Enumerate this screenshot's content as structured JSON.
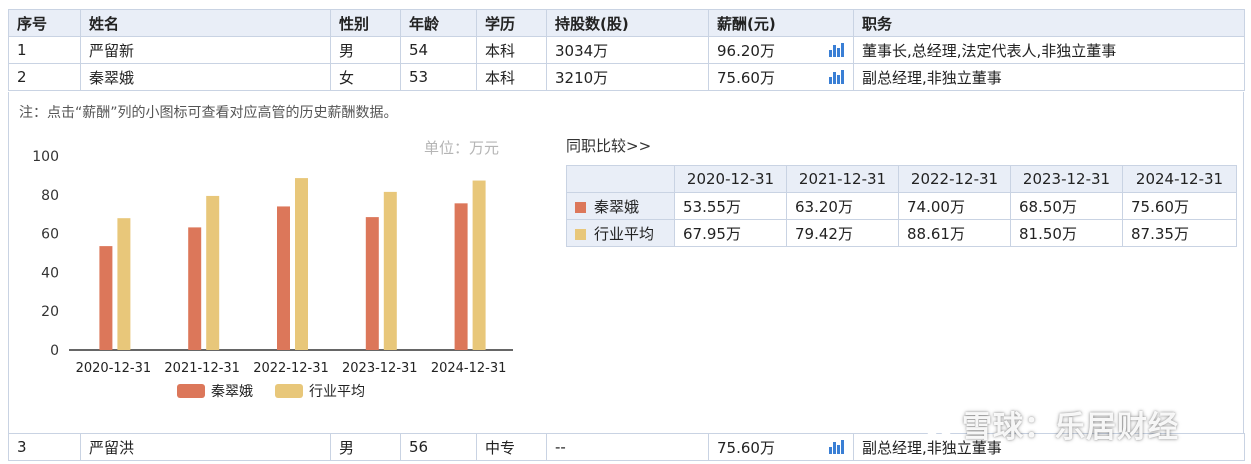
{
  "table": {
    "headers": [
      "序号",
      "姓名",
      "性别",
      "年龄",
      "学历",
      "持股数(股)",
      "薪酬(元)",
      "职务"
    ],
    "rows": [
      {
        "no": "1",
        "name": "严留新",
        "gender": "男",
        "age": "54",
        "edu": "本科",
        "shares": "3034万",
        "salary": "96.20万",
        "title": "董事长,总经理,法定代表人,非独立董事"
      },
      {
        "no": "2",
        "name": "秦翠娥",
        "gender": "女",
        "age": "53",
        "edu": "本科",
        "shares": "3210万",
        "salary": "75.60万",
        "title": "副总经理,非独立董事"
      },
      {
        "no": "3",
        "name": "严留洪",
        "gender": "男",
        "age": "56",
        "edu": "中专",
        "shares": "--",
        "salary": "75.60万",
        "title": "副总经理,非独立董事"
      }
    ]
  },
  "detail": {
    "note": "注：点击“薪酬”列的小图标可查看对应高管的历史薪酬数据。",
    "unit": "单位：万元",
    "compare_title": "同职比较>>",
    "compare_headers": [
      "2020-12-31",
      "2021-12-31",
      "2022-12-31",
      "2023-12-31",
      "2024-12-31"
    ],
    "compare_rows": [
      {
        "label": "秦翠娥",
        "color": "#dc775a",
        "values": [
          "53.55万",
          "63.20万",
          "74.00万",
          "68.50万",
          "75.60万"
        ]
      },
      {
        "label": "行业平均",
        "color": "#e8c77a",
        "values": [
          "67.95万",
          "79.42万",
          "88.61万",
          "81.50万",
          "87.35万"
        ]
      }
    ]
  },
  "chart_data": {
    "type": "bar",
    "categories": [
      "2020-12-31",
      "2021-12-31",
      "2022-12-31",
      "2023-12-31",
      "2024-12-31"
    ],
    "series": [
      {
        "name": "秦翠娥",
        "color": "#dc775a",
        "values": [
          53.55,
          63.2,
          74.0,
          68.5,
          75.6
        ]
      },
      {
        "name": "行业平均",
        "color": "#e8c77a",
        "values": [
          67.95,
          79.42,
          88.61,
          81.5,
          87.35
        ]
      }
    ],
    "yticks": [
      0,
      20,
      40,
      60,
      80,
      100
    ],
    "ylim": [
      0,
      100
    ],
    "legend": "bottom",
    "grid": false
  },
  "watermark": "雪球：乐居财经"
}
